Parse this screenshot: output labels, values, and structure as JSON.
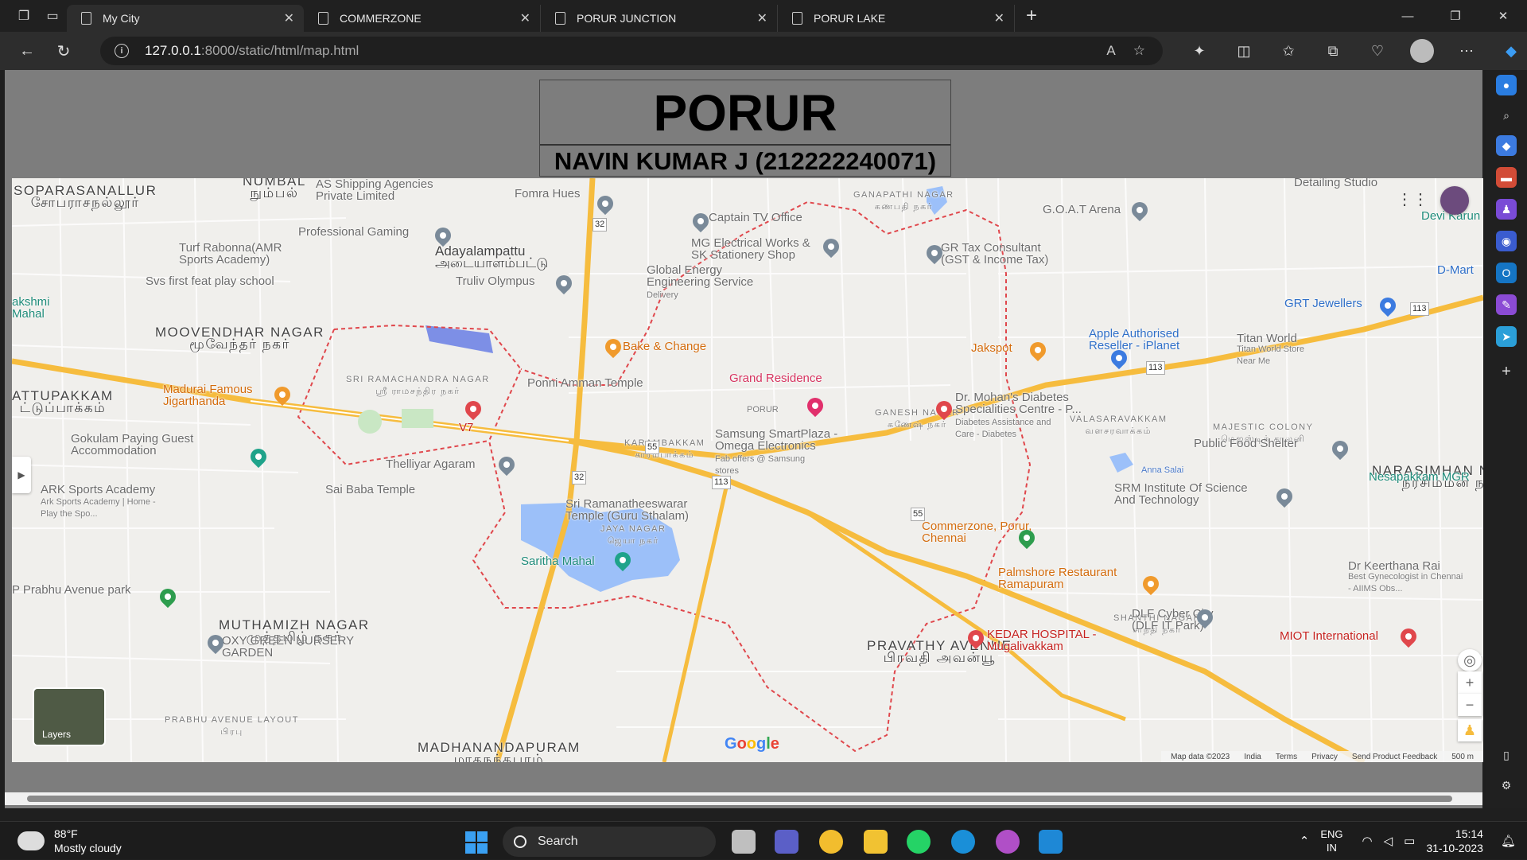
{
  "browser": {
    "tabs": [
      {
        "title": "My City",
        "active": true
      },
      {
        "title": "COMMERZONE",
        "active": false
      },
      {
        "title": "PORUR JUNCTION",
        "active": false
      },
      {
        "title": "PORUR LAKE",
        "active": false
      }
    ],
    "address": {
      "host": "127.0.0.1",
      "path": ":8000/static/html/map.html"
    }
  },
  "page": {
    "title": "PORUR",
    "subtitle": "NAVIN KUMAR J (212222240071)"
  },
  "map": {
    "areas": [
      {
        "text": "SOPARASANALLUR",
        "sub": "சோபராசநல்லூர்"
      },
      {
        "text": "NUMBAL",
        "sub": "நும்பல்"
      },
      {
        "text": "MOOVENDHAR NAGAR",
        "sub": "மூவேந்தர் நகர்"
      },
      {
        "text": "ATTUPAKKAM",
        "sub": "ட்டுப்பாக்கம்"
      },
      {
        "text": "MUTHAMIZH NAGAR",
        "sub": "முத்தமிழ் நகர்"
      },
      {
        "text": "MADHANANDAPURAM",
        "sub": "மாதநந்தபுரம்"
      },
      {
        "text": "PRAVATHY AVENUE",
        "sub": "பிரவதி அவன்யூ"
      },
      {
        "text": "NARASIMHAN NAGAR",
        "sub": "நரசிம்மன் நகர்"
      },
      {
        "text": "GANESH NAGAR",
        "sub": "கணேஷ் நகர்"
      },
      {
        "text": "SRI RAMACHANDRA NAGAR",
        "sub": "ஸ்ரீ ராமசந்திர நகர்"
      },
      {
        "text": "KARAMBAKKAM",
        "sub": "காரம்பாக்கம்"
      },
      {
        "text": "JAYA NAGAR",
        "sub": "ஜெயா நகர்"
      },
      {
        "text": "SHANTHI NAGAR",
        "sub": "சாந்தி நகர்"
      },
      {
        "text": "MAJESTIC COLONY",
        "sub": "மெஜஸ்டிக் காலனி"
      },
      {
        "text": "VALASARAVAKKAM",
        "sub": "வளசரவாக்கம்"
      },
      {
        "text": "GANAPATHI NAGAR",
        "sub": "கணபதி நகர்"
      },
      {
        "text": "PRABHU AVENUE LAYOUT",
        "sub": "பிரபு"
      }
    ],
    "pois": {
      "adayalampattu": "Adayalampattu",
      "adayalampattu_ta": "அடையாளம்பட்டு",
      "as_shipping": "AS Shipping Agencies Private Limited",
      "fomra": "Fomra Hues",
      "captain_tv": "Captain TV Office",
      "mg_electrical": "MG Electrical Works & SK Stationery Shop",
      "global_energy": "Global Energy Engineering Service",
      "global_delivery": "Delivery",
      "professional_gaming": "Professional Gaming",
      "turf_rabonna": "Turf Rabonna(AMR Sports Academy)",
      "svs_play": "Svs first feat play school",
      "truliv": "Truliv Olympus",
      "bake_change": "Bake & Change",
      "ponni_amman": "Ponni Amman Temple",
      "grand_residence": "Grand Residence",
      "madurai": "Madurai Famous Jigarthanda",
      "v7": "V7",
      "gokulam": "Gokulam Paying Guest Accommodation",
      "thelliyar": "Thelliyar Agaram",
      "samsung": "Samsung SmartPlaza - Omega Electronics",
      "samsung_sub": "Fab offers @ Samsung stores",
      "ark": "ARK Sports Academy",
      "ark_sub": "Ark Sports Academy | Home - Play the Spo...",
      "sai_baba": "Sai Baba Temple",
      "sri_ramana": "Sri Ramanatheeswarar Temple (Guru Sthalam)",
      "saritha": "Saritha Mahal",
      "prabhu_park": "P Prabhu Avenue park",
      "oxy_green": "OXY GREEN NURSERY GARDEN",
      "commerzone": "Commerzone, Porur, Chennai",
      "palmshore": "Palmshore Restaurant Ramapuram",
      "kedar": "KEDAR HOSPITAL - Mugalivakkam",
      "dlf": "DLF Cyber City (DLF IT Park)",
      "miot": "MIOT International",
      "keerthana": "Dr Keerthana Rai",
      "keerthana_sub": "Best Gynecologist in Chennai - AIIMS Obs...",
      "srm": "SRM Institute Of Science And Technology",
      "nesapakkam": "Nesapakkam MGR",
      "public_food": "Public Food Shelter",
      "mohans": "Dr. Mohan's Diabetes Specialities Centre - P...",
      "mohans_sub": "Diabetes Assistance and Care - Diabetes",
      "apple": "Apple Authorised Reseller - iPlanet",
      "titan": "Titan World",
      "titan_sub": "Titan World Store Near Me",
      "jakspot": "Jakspot",
      "grt": "GRT Jewellers",
      "gr_tax": "GR Tax Consultant (GST & Income Tax)",
      "goat": "G.O.A.T Arena",
      "detailing": "Detailing Studio",
      "devi_karu": "Devi Karun",
      "dmart": "D-Mart",
      "ilakshmi": "akshmi Mahal",
      "porur_lbl": "PORUR"
    },
    "roads": {
      "anna_salai": "Anna Salai",
      "r32": "32",
      "r55": "55",
      "r113": "113"
    },
    "layers_label": "Layers",
    "google": "Google",
    "attribution": [
      "Map data ©2023",
      "India",
      "Terms",
      "Privacy",
      "Send Product Feedback",
      "500 m"
    ]
  },
  "taskbar": {
    "weather_temp": "88°F",
    "weather_desc": "Mostly cloudy",
    "search": "Search",
    "lang1": "ENG",
    "lang2": "IN",
    "time": "15:14",
    "date": "31-10-2023"
  },
  "colors": {
    "accent": "#f6bc3e",
    "boundary": "#e0474c",
    "water": "#9cc0f9",
    "page_bg": "#7d7d7d"
  }
}
